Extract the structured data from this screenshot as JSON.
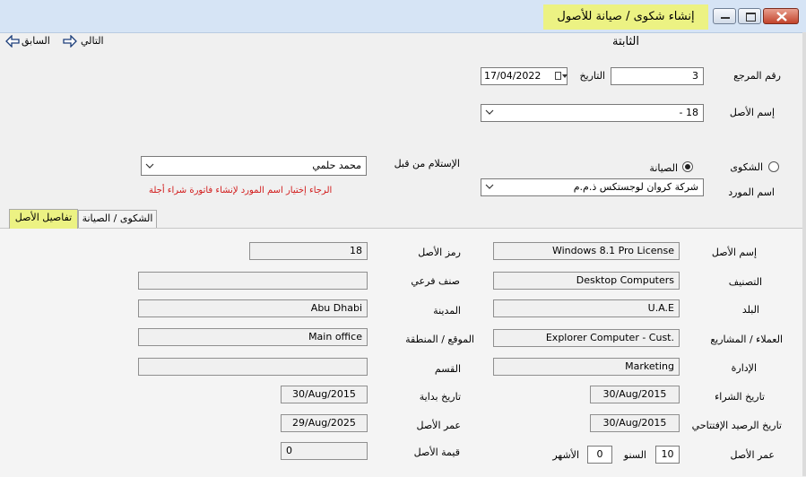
{
  "window": {
    "title": "إنشاء شكوى / صيانة للأصول الثابتة",
    "title_highlight": "#ecf283"
  },
  "nav": {
    "next_label": "التالي",
    "prev_label": "السابق"
  },
  "header": {
    "ref_label": "رقم المرجع",
    "ref_value": "3",
    "date_label": "التاريخ",
    "date_value": "17/04/2022",
    "asset_name_label": "إسم الأصل",
    "asset_value": "18 -"
  },
  "type": {
    "complaint_label": "الشكوى",
    "maintenance_label": "الصيانة",
    "selected": "maintenance"
  },
  "supplier": {
    "label": "اسم المورد",
    "value": "شركة كروان لوجستكس ذ.م.م"
  },
  "received_by": {
    "label": "الإستلام من قبل",
    "value": "محمد حلمي"
  },
  "warning": {
    "text": "الرجاء إختيار اسم المورد لإنشاء فاتورة شراء أجلة",
    "color": "#d21b1b"
  },
  "tabs": [
    {
      "label": "تفاصيل الأصل",
      "active": true
    },
    {
      "label": "الشكوى / الصيانة",
      "active": false
    }
  ],
  "details": {
    "asset_name_label": "إسم الأصل",
    "asset_name_value": "Windows 8.1 Pro License",
    "asset_code_label": "رمز الأصل",
    "asset_code_value": "18",
    "category_label": "التصنيف",
    "category_value": "Desktop Computers",
    "subcategory_label": "صنف فرعي",
    "subcategory_value": "",
    "country_label": "البلد",
    "country_value": "U.A.E",
    "city_label": "المدينة",
    "city_value": "Abu Dhabi",
    "clients_label": "العملاء / المشاريع",
    "clients_value": "Explorer Computer - Cust.",
    "location_label": "الموقع / المنطقة",
    "location_value": "Main office",
    "department_label": "الإدارة",
    "department_value": "Marketing",
    "section_label": "القسم",
    "section_value": "",
    "purchase_date_label": "تاريخ الشراء",
    "purchase_date_value": "30/Aug/2015",
    "start_date_label": "تاريخ بداية",
    "start_date_value": "30/Aug/2015",
    "opening_balance_date_label": "تاريخ الرصيد الإفتتاحي",
    "opening_balance_date_value": "30/Aug/2015",
    "asset_life_label_right": "عمر الأصل",
    "asset_life_end_value": "29/Aug/2025",
    "asset_age_label": "عمر الأصل",
    "years_label": "السنو",
    "years_value": "10",
    "months_label": "الأشهر",
    "months_value": "0",
    "asset_value_label": "قيمة الأصل",
    "asset_value_value": "0"
  }
}
